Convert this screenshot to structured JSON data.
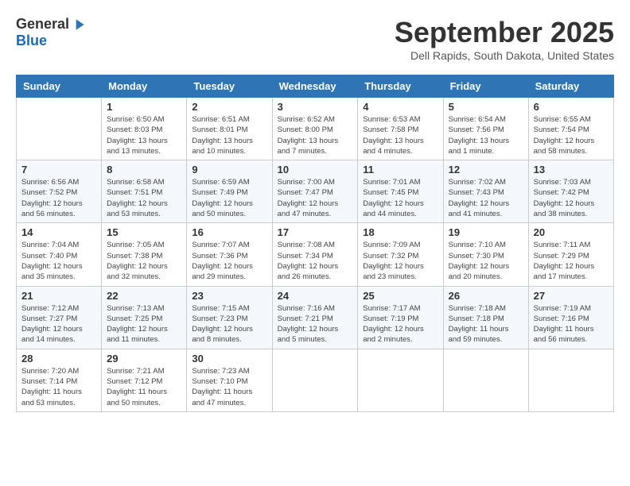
{
  "header": {
    "logo_general": "General",
    "logo_blue": "Blue",
    "month_title": "September 2025",
    "location": "Dell Rapids, South Dakota, United States"
  },
  "days_of_week": [
    "Sunday",
    "Monday",
    "Tuesday",
    "Wednesday",
    "Thursday",
    "Friday",
    "Saturday"
  ],
  "weeks": [
    [
      {
        "day": "",
        "info": ""
      },
      {
        "day": "1",
        "info": "Sunrise: 6:50 AM\nSunset: 8:03 PM\nDaylight: 13 hours\nand 13 minutes."
      },
      {
        "day": "2",
        "info": "Sunrise: 6:51 AM\nSunset: 8:01 PM\nDaylight: 13 hours\nand 10 minutes."
      },
      {
        "day": "3",
        "info": "Sunrise: 6:52 AM\nSunset: 8:00 PM\nDaylight: 13 hours\nand 7 minutes."
      },
      {
        "day": "4",
        "info": "Sunrise: 6:53 AM\nSunset: 7:58 PM\nDaylight: 13 hours\nand 4 minutes."
      },
      {
        "day": "5",
        "info": "Sunrise: 6:54 AM\nSunset: 7:56 PM\nDaylight: 13 hours\nand 1 minute."
      },
      {
        "day": "6",
        "info": "Sunrise: 6:55 AM\nSunset: 7:54 PM\nDaylight: 12 hours\nand 58 minutes."
      }
    ],
    [
      {
        "day": "7",
        "info": "Sunrise: 6:56 AM\nSunset: 7:52 PM\nDaylight: 12 hours\nand 56 minutes."
      },
      {
        "day": "8",
        "info": "Sunrise: 6:58 AM\nSunset: 7:51 PM\nDaylight: 12 hours\nand 53 minutes."
      },
      {
        "day": "9",
        "info": "Sunrise: 6:59 AM\nSunset: 7:49 PM\nDaylight: 12 hours\nand 50 minutes."
      },
      {
        "day": "10",
        "info": "Sunrise: 7:00 AM\nSunset: 7:47 PM\nDaylight: 12 hours\nand 47 minutes."
      },
      {
        "day": "11",
        "info": "Sunrise: 7:01 AM\nSunset: 7:45 PM\nDaylight: 12 hours\nand 44 minutes."
      },
      {
        "day": "12",
        "info": "Sunrise: 7:02 AM\nSunset: 7:43 PM\nDaylight: 12 hours\nand 41 minutes."
      },
      {
        "day": "13",
        "info": "Sunrise: 7:03 AM\nSunset: 7:42 PM\nDaylight: 12 hours\nand 38 minutes."
      }
    ],
    [
      {
        "day": "14",
        "info": "Sunrise: 7:04 AM\nSunset: 7:40 PM\nDaylight: 12 hours\nand 35 minutes."
      },
      {
        "day": "15",
        "info": "Sunrise: 7:05 AM\nSunset: 7:38 PM\nDaylight: 12 hours\nand 32 minutes."
      },
      {
        "day": "16",
        "info": "Sunrise: 7:07 AM\nSunset: 7:36 PM\nDaylight: 12 hours\nand 29 minutes."
      },
      {
        "day": "17",
        "info": "Sunrise: 7:08 AM\nSunset: 7:34 PM\nDaylight: 12 hours\nand 26 minutes."
      },
      {
        "day": "18",
        "info": "Sunrise: 7:09 AM\nSunset: 7:32 PM\nDaylight: 12 hours\nand 23 minutes."
      },
      {
        "day": "19",
        "info": "Sunrise: 7:10 AM\nSunset: 7:30 PM\nDaylight: 12 hours\nand 20 minutes."
      },
      {
        "day": "20",
        "info": "Sunrise: 7:11 AM\nSunset: 7:29 PM\nDaylight: 12 hours\nand 17 minutes."
      }
    ],
    [
      {
        "day": "21",
        "info": "Sunrise: 7:12 AM\nSunset: 7:27 PM\nDaylight: 12 hours\nand 14 minutes."
      },
      {
        "day": "22",
        "info": "Sunrise: 7:13 AM\nSunset: 7:25 PM\nDaylight: 12 hours\nand 11 minutes."
      },
      {
        "day": "23",
        "info": "Sunrise: 7:15 AM\nSunset: 7:23 PM\nDaylight: 12 hours\nand 8 minutes."
      },
      {
        "day": "24",
        "info": "Sunrise: 7:16 AM\nSunset: 7:21 PM\nDaylight: 12 hours\nand 5 minutes."
      },
      {
        "day": "25",
        "info": "Sunrise: 7:17 AM\nSunset: 7:19 PM\nDaylight: 12 hours\nand 2 minutes."
      },
      {
        "day": "26",
        "info": "Sunrise: 7:18 AM\nSunset: 7:18 PM\nDaylight: 11 hours\nand 59 minutes."
      },
      {
        "day": "27",
        "info": "Sunrise: 7:19 AM\nSunset: 7:16 PM\nDaylight: 11 hours\nand 56 minutes."
      }
    ],
    [
      {
        "day": "28",
        "info": "Sunrise: 7:20 AM\nSunset: 7:14 PM\nDaylight: 11 hours\nand 53 minutes."
      },
      {
        "day": "29",
        "info": "Sunrise: 7:21 AM\nSunset: 7:12 PM\nDaylight: 11 hours\nand 50 minutes."
      },
      {
        "day": "30",
        "info": "Sunrise: 7:23 AM\nSunset: 7:10 PM\nDaylight: 11 hours\nand 47 minutes."
      },
      {
        "day": "",
        "info": ""
      },
      {
        "day": "",
        "info": ""
      },
      {
        "day": "",
        "info": ""
      },
      {
        "day": "",
        "info": ""
      }
    ]
  ]
}
